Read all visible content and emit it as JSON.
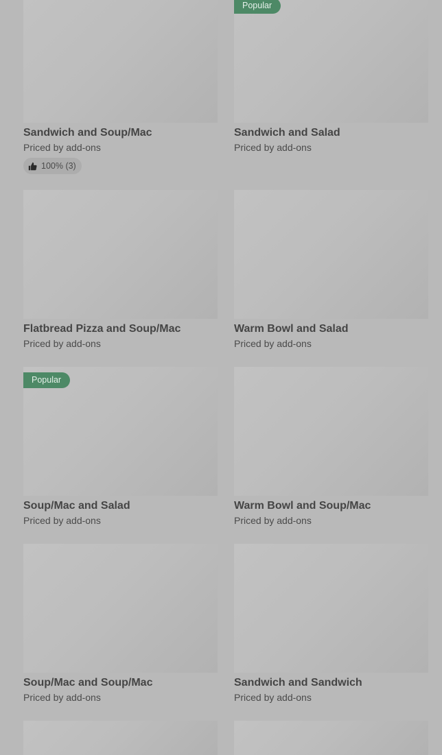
{
  "items": [
    {
      "title": "Sandwich and Soup/Mac",
      "subtitle": "Priced by add-ons",
      "badge": "",
      "rating": "100% (3)"
    },
    {
      "title": "Sandwich and Salad",
      "subtitle": "Priced by add-ons",
      "badge": "Popular",
      "rating": ""
    },
    {
      "title": "Flatbread Pizza and Soup/Mac",
      "subtitle": "Priced by add-ons",
      "badge": "",
      "rating": ""
    },
    {
      "title": "Warm Bowl and Salad",
      "subtitle": "Priced by add-ons",
      "badge": "",
      "rating": ""
    },
    {
      "title": "Soup/Mac and Salad",
      "subtitle": "Priced by add-ons",
      "badge": "Popular",
      "rating": ""
    },
    {
      "title": "Warm Bowl and Soup/Mac",
      "subtitle": "Priced by add-ons",
      "badge": "",
      "rating": ""
    },
    {
      "title": "Soup/Mac and Soup/Mac",
      "subtitle": "Priced by add-ons",
      "badge": "",
      "rating": ""
    },
    {
      "title": "Sandwich and Sandwich",
      "subtitle": "Priced by add-ons",
      "badge": "",
      "rating": ""
    }
  ],
  "colors": {
    "page_background": "#b9b9b9",
    "badge_background": "#4d8966",
    "text_primary": "#454545"
  },
  "icons": {
    "rating": "thumbs-up-icon"
  }
}
